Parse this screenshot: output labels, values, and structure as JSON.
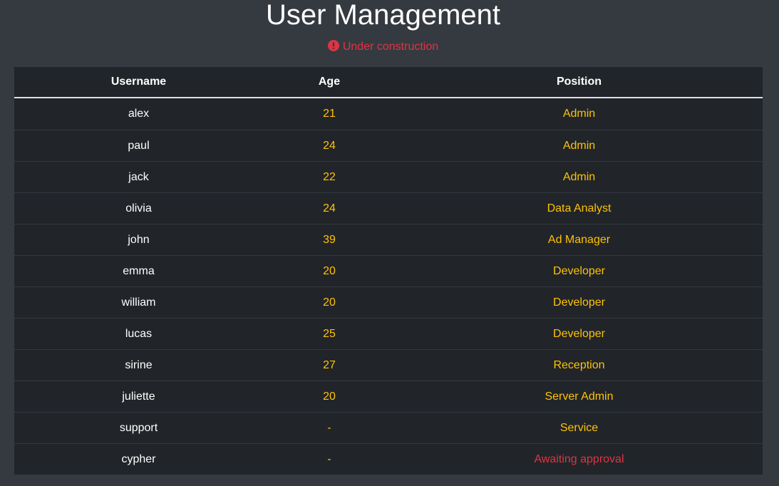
{
  "page": {
    "title": "User Management",
    "status_text": "Under construction",
    "status_icon": "exclamation-circle-icon"
  },
  "colors": {
    "background": "#343a40",
    "table_background": "#212529",
    "warning": "#ffc107",
    "danger": "#dc3545",
    "text": "#ffffff"
  },
  "table": {
    "headers": [
      "Username",
      "Age",
      "Position"
    ],
    "rows": [
      {
        "username": "alex",
        "age": "21",
        "position": "Admin",
        "status": "warning"
      },
      {
        "username": "paul",
        "age": "24",
        "position": "Admin",
        "status": "warning"
      },
      {
        "username": "jack",
        "age": "22",
        "position": "Admin",
        "status": "warning"
      },
      {
        "username": "olivia",
        "age": "24",
        "position": "Data Analyst",
        "status": "warning"
      },
      {
        "username": "john",
        "age": "39",
        "position": "Ad Manager",
        "status": "warning"
      },
      {
        "username": "emma",
        "age": "20",
        "position": "Developer",
        "status": "warning"
      },
      {
        "username": "william",
        "age": "20",
        "position": "Developer",
        "status": "warning"
      },
      {
        "username": "lucas",
        "age": "25",
        "position": "Developer",
        "status": "warning"
      },
      {
        "username": "sirine",
        "age": "27",
        "position": "Reception",
        "status": "warning"
      },
      {
        "username": "juliette",
        "age": "20",
        "position": "Server Admin",
        "status": "warning"
      },
      {
        "username": "support",
        "age": "-",
        "position": "Service",
        "status": "warning"
      },
      {
        "username": "cypher",
        "age": "-",
        "position": "Awaiting approval",
        "status": "danger"
      }
    ]
  }
}
